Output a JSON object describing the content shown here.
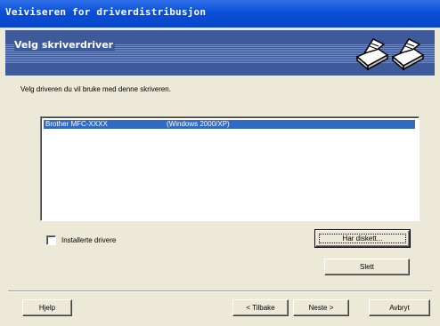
{
  "window": {
    "title": "Veiviseren for driverdistribusjon"
  },
  "banner": {
    "title": "Velg skriverdriver",
    "icon": "printer-icon"
  },
  "instruction": "Velg driveren du vil bruke med denne skriveren.",
  "driver_list": {
    "items": [
      {
        "name": "Brother  MFC-XXXX",
        "os": "(Windows 2000/XP)",
        "selected": true
      }
    ]
  },
  "checkbox": {
    "label": "Installerte drivere",
    "checked": false
  },
  "buttons": {
    "have_disk": "Har diskett...",
    "delete": "Slett",
    "help": "Hjelp",
    "back": "< Tilbake",
    "next": "Neste >",
    "cancel": "Avbryt"
  },
  "colors": {
    "title_bar": "#0a4fd8",
    "banner": "#3e5a9b",
    "selection": "#316ac5",
    "dialog": "#ece9d8"
  }
}
